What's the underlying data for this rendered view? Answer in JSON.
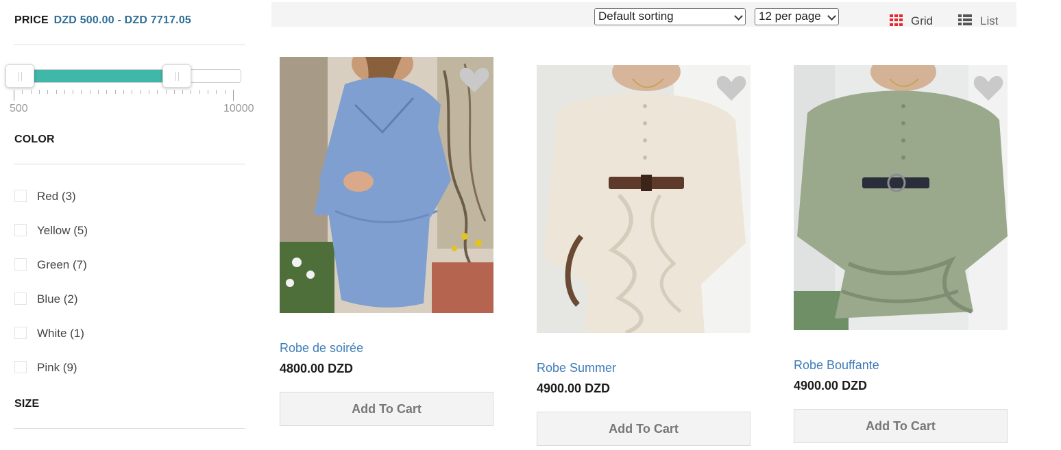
{
  "filters": {
    "price": {
      "title": "PRICE",
      "range_text": "DZD 500.00 - DZD 7717.05",
      "min_label": "500",
      "max_label": "10000",
      "selected_min": 500,
      "selected_max": 7717.05,
      "scale_min": 500,
      "scale_max": 10000,
      "fill_color": "#3fb7a9"
    },
    "color": {
      "title": "COLOR",
      "options": [
        {
          "label": "Red (3)"
        },
        {
          "label": "Yellow (5)"
        },
        {
          "label": "Green (7)"
        },
        {
          "label": "Blue (2)"
        },
        {
          "label": "White (1)"
        },
        {
          "label": "Pink (9)"
        }
      ]
    },
    "size": {
      "title": "SIZE"
    }
  },
  "toolbar": {
    "sort_value": "Default sorting",
    "per_page_value": "12 per page",
    "grid_label": "Grid",
    "list_label": "List",
    "grid_icon": "grid-icon",
    "list_icon": "list-icon",
    "active_view": "grid",
    "accent_color": "#e8282e"
  },
  "products": [
    {
      "name": "Robe de soirée",
      "price": "4800.00 DZD",
      "cart_label": "Add To Cart",
      "dress_color": "#7f9fd0",
      "wishlist_icon": "heart-icon"
    },
    {
      "name": "Robe Summer",
      "price": "4900.00 DZD",
      "cart_label": "Add To Cart",
      "dress_color": "#ede6d8",
      "wishlist_icon": "heart-icon"
    },
    {
      "name": "Robe Bouffante",
      "price": "4900.00 DZD",
      "cart_label": "Add To Cart",
      "dress_color": "#9aa88c",
      "wishlist_icon": "heart-icon"
    }
  ]
}
